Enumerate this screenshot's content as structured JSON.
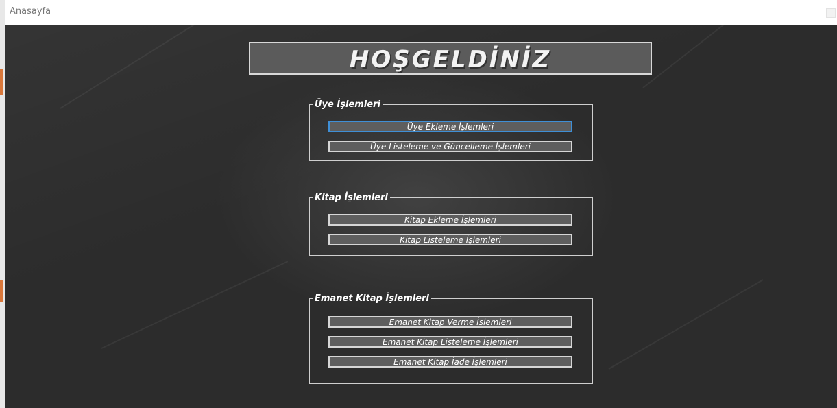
{
  "window": {
    "title": "Anasayfa"
  },
  "welcome": {
    "text": "HOŞGELDİNİZ"
  },
  "groups": [
    {
      "legend": "Üye İşlemleri",
      "buttons": [
        "Üye Ekleme İşlemleri",
        "Üye Listeleme ve Güncelleme İşlemleri"
      ]
    },
    {
      "legend": "Kitap İşlemleri",
      "buttons": [
        "Kitap Ekleme İşlemleri",
        "Kitap Listeleme İşlemleri"
      ]
    },
    {
      "legend": "Emanet Kitap İşlemleri",
      "buttons": [
        "Emanet Kitap Verme İşlemleri",
        "Emanet Kitap Listeleme İşlemleri",
        "Emanet Kitap İade İşlemleri"
      ]
    }
  ],
  "colors": {
    "background": "#2c2c2c",
    "button": "#5e5e5e",
    "button_border": "#d6d6d6",
    "focus_border": "#3f8fd6"
  }
}
